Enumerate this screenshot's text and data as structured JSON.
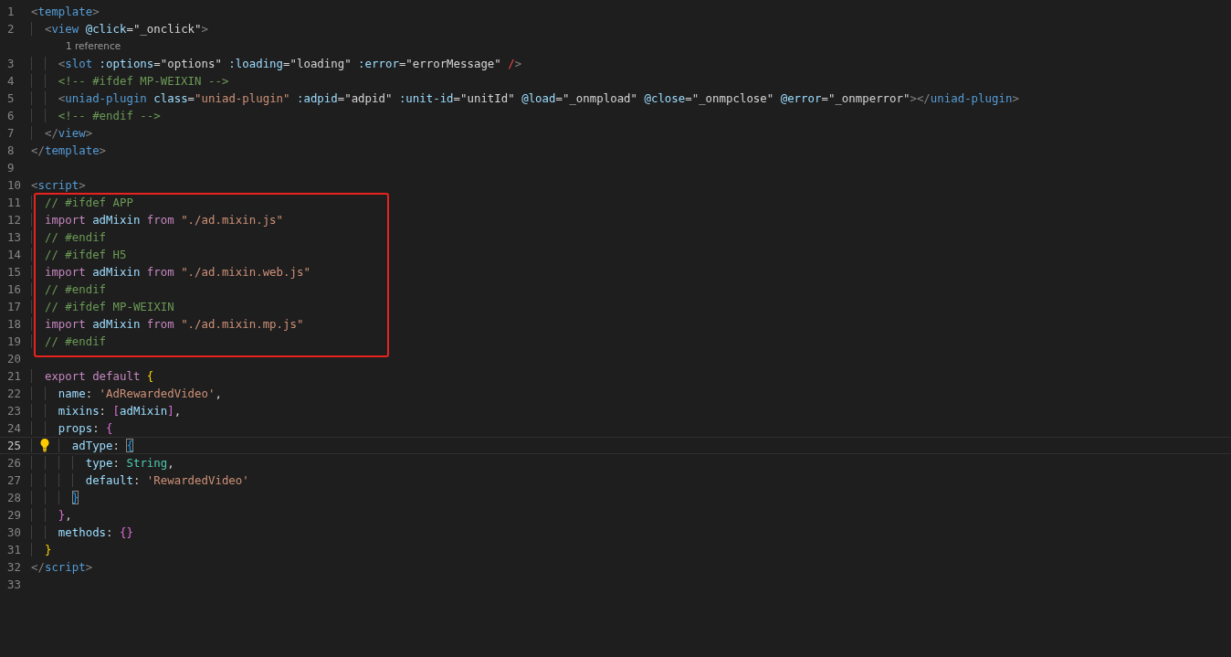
{
  "editor": {
    "lines": [
      {
        "kind": "code",
        "number": "1",
        "current": false,
        "tokens": [
          {
            "kind": "punct",
            "text": "<"
          },
          {
            "kind": "tag",
            "text": "template"
          },
          {
            "kind": "punct",
            "text": ">"
          }
        ]
      },
      {
        "kind": "code",
        "number": "2",
        "current": false,
        "tokens": [
          {
            "kind": "punct",
            "text": "  <"
          },
          {
            "kind": "tag",
            "text": "view"
          },
          {
            "kind": "attr",
            "text": " @click"
          },
          {
            "kind": "op",
            "text": "="
          },
          {
            "kind": "expr",
            "text": "\"_onclick\""
          },
          {
            "kind": "punct",
            "text": ">"
          }
        ]
      },
      {
        "kind": "codelens",
        "text": "1 reference",
        "current": false
      },
      {
        "kind": "code",
        "number": "3",
        "current": false,
        "tokens": [
          {
            "kind": "punct",
            "text": "    <"
          },
          {
            "kind": "tag",
            "text": "slot"
          },
          {
            "kind": "attr",
            "text": " :options"
          },
          {
            "kind": "op",
            "text": "="
          },
          {
            "kind": "expr",
            "text": "\"options\""
          },
          {
            "kind": "attr",
            "text": " :loading"
          },
          {
            "kind": "op",
            "text": "="
          },
          {
            "kind": "expr",
            "text": "\"loading\""
          },
          {
            "kind": "attr",
            "text": " :error"
          },
          {
            "kind": "op",
            "text": "="
          },
          {
            "kind": "expr",
            "text": "\"errorMessage\""
          },
          {
            "kind": "err",
            "text": " /"
          },
          {
            "kind": "punct",
            "text": ">"
          }
        ]
      },
      {
        "kind": "code",
        "number": "4",
        "current": false,
        "tokens": [
          {
            "kind": "comment",
            "text": "    <!-- #ifdef MP-WEIXIN -->"
          }
        ]
      },
      {
        "kind": "code",
        "number": "5",
        "current": false,
        "tokens": [
          {
            "kind": "punct",
            "text": "    <"
          },
          {
            "kind": "tag",
            "text": "uniad-plugin"
          },
          {
            "kind": "attr",
            "text": " class"
          },
          {
            "kind": "op",
            "text": "="
          },
          {
            "kind": "str",
            "text": "\"uniad-plugin\""
          },
          {
            "kind": "attr",
            "text": " :adpid"
          },
          {
            "kind": "op",
            "text": "="
          },
          {
            "kind": "expr",
            "text": "\"adpid\""
          },
          {
            "kind": "attr",
            "text": " :unit-id"
          },
          {
            "kind": "op",
            "text": "="
          },
          {
            "kind": "expr",
            "text": "\"unitId\""
          },
          {
            "kind": "attr",
            "text": " @load"
          },
          {
            "kind": "op",
            "text": "="
          },
          {
            "kind": "expr",
            "text": "\"_onmpload\""
          },
          {
            "kind": "attr",
            "text": " @close"
          },
          {
            "kind": "op",
            "text": "="
          },
          {
            "kind": "expr",
            "text": "\"_onmpclose\""
          },
          {
            "kind": "attr",
            "text": " @error"
          },
          {
            "kind": "op",
            "text": "="
          },
          {
            "kind": "expr",
            "text": "\"_onmperror\""
          },
          {
            "kind": "punct",
            "text": "></"
          },
          {
            "kind": "tag",
            "text": "uniad-plugin"
          },
          {
            "kind": "punct",
            "text": ">"
          }
        ]
      },
      {
        "kind": "code",
        "number": "6",
        "current": false,
        "tokens": [
          {
            "kind": "comment",
            "text": "    <!-- #endif -->"
          }
        ]
      },
      {
        "kind": "code",
        "number": "7",
        "current": false,
        "tokens": [
          {
            "kind": "punct",
            "text": "  </"
          },
          {
            "kind": "tag",
            "text": "view"
          },
          {
            "kind": "punct",
            "text": ">"
          }
        ]
      },
      {
        "kind": "code",
        "number": "8",
        "current": false,
        "tokens": [
          {
            "kind": "punct",
            "text": "</"
          },
          {
            "kind": "tag",
            "text": "template"
          },
          {
            "kind": "punct",
            "text": ">"
          }
        ]
      },
      {
        "kind": "code",
        "number": "9",
        "current": false
      },
      {
        "kind": "code",
        "number": "10",
        "current": false,
        "tokens": [
          {
            "kind": "punct",
            "text": "<"
          },
          {
            "kind": "tag",
            "text": "script"
          },
          {
            "kind": "punct",
            "text": ">"
          }
        ]
      },
      {
        "kind": "annotation",
        "children": [
          {
            "kind": "code",
            "number": "11",
            "current": false,
            "tokens": [
              {
                "kind": "comment",
                "text": "  // #ifdef APP"
              }
            ]
          },
          {
            "kind": "code",
            "number": "12",
            "current": false,
            "tokens": [
              {
                "kind": "kw",
                "text": "  import"
              },
              {
                "kind": "var",
                "text": " adMixin"
              },
              {
                "kind": "kw",
                "text": " from"
              },
              {
                "kind": "str",
                "text": " \"./ad.mixin.js\""
              }
            ]
          },
          {
            "kind": "code",
            "number": "13",
            "current": false,
            "tokens": [
              {
                "kind": "comment",
                "text": "  // #endif"
              }
            ]
          },
          {
            "kind": "code",
            "number": "14",
            "current": false,
            "tokens": [
              {
                "kind": "comment",
                "text": "  // #ifdef H5"
              }
            ]
          },
          {
            "kind": "code",
            "number": "15",
            "current": false,
            "tokens": [
              {
                "kind": "kw",
                "text": "  import"
              },
              {
                "kind": "var",
                "text": " adMixin"
              },
              {
                "kind": "kw",
                "text": " from"
              },
              {
                "kind": "str",
                "text": " \"./ad.mixin.web.js\""
              }
            ]
          },
          {
            "kind": "code",
            "number": "16",
            "current": false,
            "tokens": [
              {
                "kind": "comment",
                "text": "  // #endif"
              }
            ]
          },
          {
            "kind": "code",
            "number": "17",
            "current": false,
            "tokens": [
              {
                "kind": "comment",
                "text": "  // #ifdef MP-WEIXIN"
              }
            ]
          },
          {
            "kind": "code",
            "number": "18",
            "current": false,
            "tokens": [
              {
                "kind": "kw",
                "text": "  import"
              },
              {
                "kind": "var",
                "text": " adMixin"
              },
              {
                "kind": "kw",
                "text": " from"
              },
              {
                "kind": "str",
                "text": " \"./ad.mixin.mp.js\""
              }
            ]
          },
          {
            "kind": "code",
            "number": "19",
            "current": false,
            "tokens": [
              {
                "kind": "comment",
                "text": "  // #endif"
              }
            ]
          }
        ]
      },
      {
        "kind": "code",
        "number": "20",
        "current": false
      },
      {
        "kind": "code",
        "number": "21",
        "current": false,
        "tokens": [
          {
            "kind": "kw",
            "text": "  export default"
          },
          {
            "kind": "br1",
            "text": " {"
          }
        ]
      },
      {
        "kind": "code",
        "number": "22",
        "current": false,
        "tokens": [
          {
            "kind": "var",
            "text": "    name"
          },
          {
            "kind": "op",
            "text": ":"
          },
          {
            "kind": "str",
            "text": " 'AdRewardedVideo'"
          },
          {
            "kind": "op",
            "text": ","
          }
        ]
      },
      {
        "kind": "code",
        "number": "23",
        "current": false,
        "tokens": [
          {
            "kind": "var",
            "text": "    mixins"
          },
          {
            "kind": "op",
            "text": ":"
          },
          {
            "kind": "br2",
            "text": " ["
          },
          {
            "kind": "var",
            "text": "adMixin"
          },
          {
            "kind": "br2",
            "text": "]"
          },
          {
            "kind": "op",
            "text": ","
          }
        ]
      },
      {
        "kind": "code",
        "number": "24",
        "current": false,
        "tokens": [
          {
            "kind": "var",
            "text": "    props"
          },
          {
            "kind": "op",
            "text": ":"
          },
          {
            "kind": "br2",
            "text": " {"
          }
        ]
      },
      {
        "kind": "code",
        "number": "25",
        "current": true,
        "tokens": [
          {
            "kind": "var",
            "text": "      adType"
          },
          {
            "kind": "op",
            "text": ": "
          },
          {
            "kind": "brm",
            "text": "{"
          }
        ]
      },
      {
        "kind": "code",
        "number": "26",
        "current": false,
        "tokens": [
          {
            "kind": "var",
            "text": "        type"
          },
          {
            "kind": "op",
            "text": ":"
          },
          {
            "kind": "type",
            "text": " String"
          },
          {
            "kind": "op",
            "text": ","
          }
        ]
      },
      {
        "kind": "code",
        "number": "27",
        "current": false,
        "tokens": [
          {
            "kind": "var",
            "text": "        default"
          },
          {
            "kind": "op",
            "text": ":"
          },
          {
            "kind": "str",
            "text": " 'RewardedVideo'"
          }
        ]
      },
      {
        "kind": "code",
        "number": "28",
        "current": false,
        "tokens": [
          {
            "kind": "brm",
            "text": "      }"
          }
        ]
      },
      {
        "kind": "code",
        "number": "29",
        "current": false,
        "tokens": [
          {
            "kind": "br2",
            "text": "    }"
          },
          {
            "kind": "op",
            "text": ","
          }
        ]
      },
      {
        "kind": "code",
        "number": "30",
        "current": false,
        "tokens": [
          {
            "kind": "var",
            "text": "    methods"
          },
          {
            "kind": "op",
            "text": ":"
          },
          {
            "kind": "br2",
            "text": " {}"
          }
        ]
      },
      {
        "kind": "code",
        "number": "31",
        "current": false,
        "tokens": [
          {
            "kind": "br1",
            "text": "  }"
          }
        ]
      },
      {
        "kind": "code",
        "number": "32",
        "current": false,
        "tokens": [
          {
            "kind": "punct",
            "text": "</"
          },
          {
            "kind": "tag",
            "text": "script"
          },
          {
            "kind": "punct",
            "text": ">"
          }
        ]
      },
      {
        "kind": "code",
        "number": "33",
        "current": false
      }
    ]
  }
}
